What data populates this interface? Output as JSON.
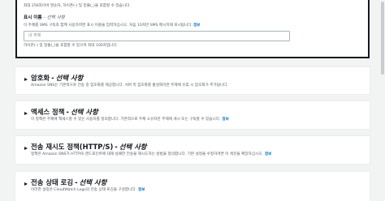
{
  "name_field": {
    "hint": "최대 256자이며 영숫자, 하이픈(-) 및 밑줄(_)을 포함할 수 있습니다."
  },
  "display_name_field": {
    "label": "표시 이름",
    "separator": "-",
    "optional": "선택 사항",
    "description": "이 주제를 SMS 구독과 함께 사용하려면 표시 이름을 입력하십시오. 처음 10자만 SMS 메시지에 표시됩니다.",
    "info": "정보",
    "placeholder": "내 주제",
    "hint": "하이픈(-) 및 밑줄(_)을 포함할 수 있으며 최대 100자입니다."
  },
  "sections": [
    {
      "title": "암호화",
      "separator": "-",
      "optional": "선택 사항",
      "description": "Amazon SNS는 기본적으로 전송 중 암호화를 제공합니다. 서버 측 암호화를 활성화하면 주제에 유휴 시 암호화가 추가됩니다.",
      "info": ""
    },
    {
      "title": "액세스 정책",
      "separator": "-",
      "optional": "선택 사항",
      "description": "이 정책은 주제에 액세스할 수 있는 사용자를 정의합니다. 기본적으로 주제 소유자만 주제에 게시 또는 구독할 수 있습니다.",
      "info": "정보"
    },
    {
      "title": "전송 재시도 정책(HTTP/S)",
      "separator": "-",
      "optional": "선택 사항",
      "description": "정책은 Amazon SNS가 HTTP/S 엔드포인트에 대해 실패한 전송을 재시도하는 방법을 정의합니다. 기본 설정을 수정하려면 이 섹션을 확장하십시오.",
      "info": "정보"
    },
    {
      "title": "전송 상태 로깅",
      "separator": "-",
      "optional": "선택 사항",
      "description": "이러한 설정은 CloudWatch Logs의 전송 상태 로깅을 구성합니다.",
      "info": "정보"
    }
  ]
}
